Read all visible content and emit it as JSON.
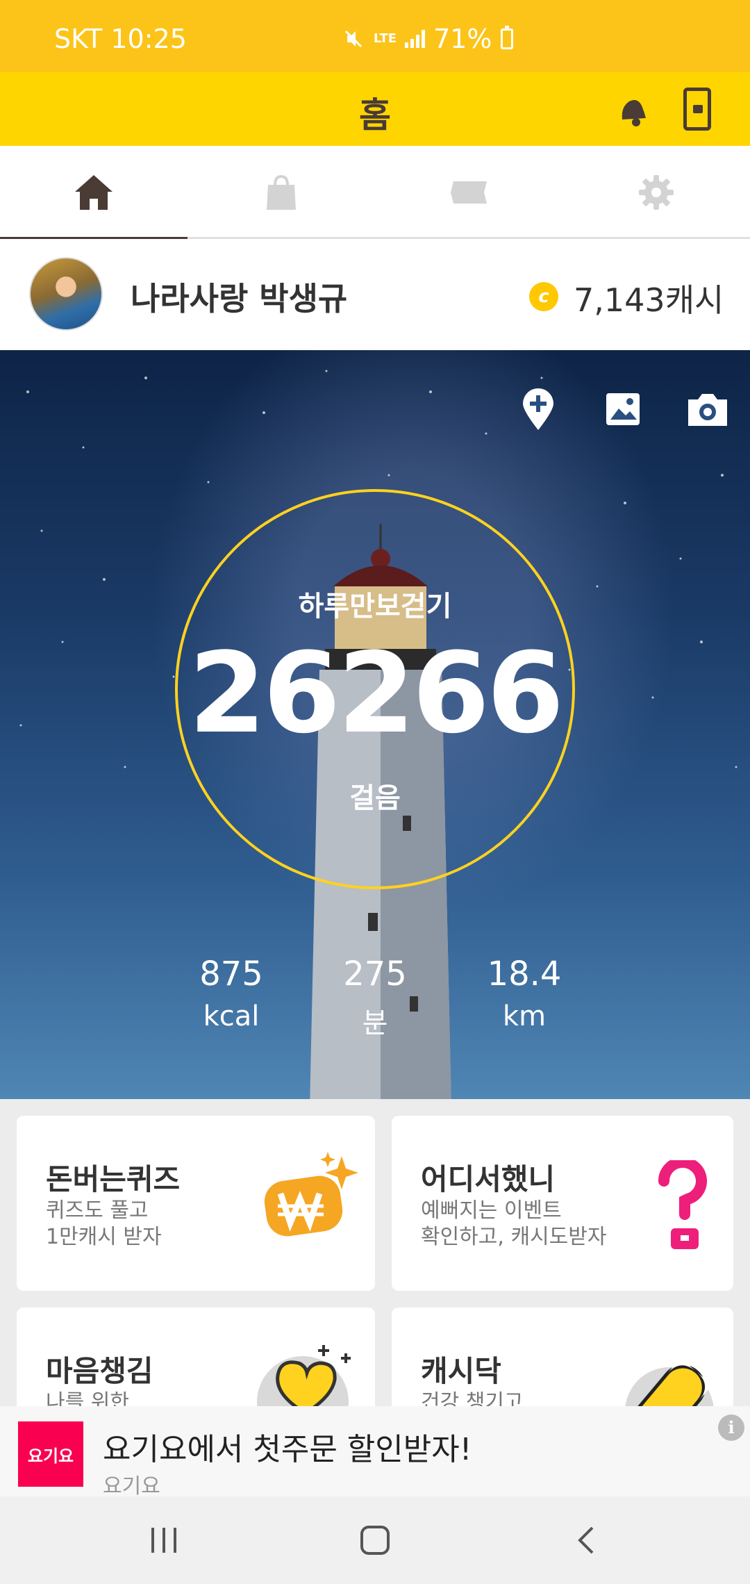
{
  "status_bar": {
    "carrier_time": "SKT 10:25",
    "network": "LTE",
    "battery": "71%"
  },
  "header": {
    "title": "홈",
    "icons": [
      "bell-icon",
      "lock-phone-icon"
    ]
  },
  "tabs": [
    {
      "name": "home",
      "icon": "home-icon",
      "active": true
    },
    {
      "name": "shop",
      "icon": "shopping-bag-icon",
      "active": false
    },
    {
      "name": "ticket",
      "icon": "ticket-icon",
      "active": false
    },
    {
      "name": "settings",
      "icon": "gear-icon",
      "active": false
    }
  ],
  "profile": {
    "username": "나라사랑 박생규",
    "coin_symbol": "c",
    "cash": "7,143캐시"
  },
  "hero": {
    "actions": [
      "add-location-icon",
      "gallery-icon",
      "camera-icon"
    ],
    "steps_label": "하루만보걷기",
    "steps": "26266",
    "steps_unit": "걸음",
    "stats": [
      {
        "value": "875",
        "unit": "kcal"
      },
      {
        "value": "275",
        "unit": "분"
      },
      {
        "value": "18.4",
        "unit": "km"
      }
    ]
  },
  "cards": [
    {
      "title": "돈버는퀴즈",
      "line1": "퀴즈도 풀고",
      "line2": "1만캐시 받자",
      "icon": "won-sparkle-icon"
    },
    {
      "title": "어디서했니",
      "line1": "예뻐지는 이벤트",
      "line2": "확인하고, 캐시도받자",
      "icon": "question-mark-icon"
    },
    {
      "title": "마음챙김",
      "line1": "나를 위한",
      "icon": "heart-hand-icon"
    },
    {
      "title": "캐시닥",
      "line1": "건강 챙기고",
      "icon": "pill-icon"
    }
  ],
  "ad": {
    "logo": "요기요",
    "title": "요기요에서 첫주문 할인받자!",
    "sponsor": "요기요",
    "info": "i"
  },
  "colors": {
    "header": "#ffd500",
    "status_bar": "#fcc419",
    "accent_ring": "#ffd21f",
    "brown": "#4a3b35",
    "ad_brand": "#fa0050"
  }
}
